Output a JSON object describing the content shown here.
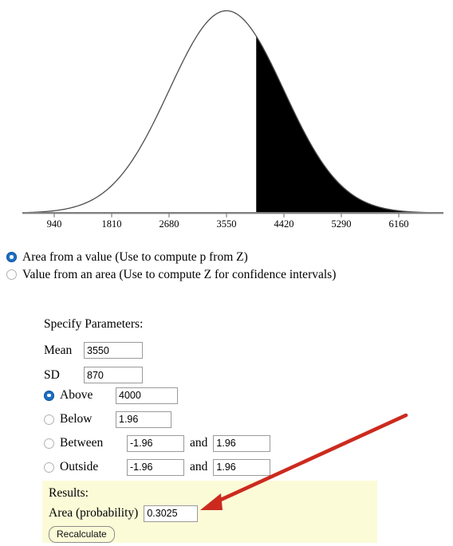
{
  "chart_data": {
    "type": "area",
    "title": "",
    "xlabel": "",
    "ylabel": "",
    "distribution": "normal",
    "mean": 3550,
    "sd": 870,
    "xlim": [
      480,
      6720
    ],
    "tick_values": [
      940,
      1810,
      2680,
      3550,
      4420,
      5290,
      6160
    ],
    "tick_labels": [
      "940",
      "1810",
      "2680",
      "3550",
      "4420",
      "5290",
      "6160"
    ],
    "shaded_region": {
      "type": "above",
      "from": 4000,
      "to": 6720,
      "area": 0.3025,
      "fill_color": "#000000"
    },
    "curve_color": "#4d4d4d",
    "axis_color": "#808080",
    "grid": false,
    "legend": false
  },
  "mode": {
    "options": [
      {
        "label": "Area from a value (Use to compute p from Z)",
        "selected": true
      },
      {
        "label": "Value from an area (Use to compute Z for confidence intervals)",
        "selected": false
      }
    ]
  },
  "parameters": {
    "title": "Specify Parameters:",
    "mean": {
      "label": "Mean",
      "value": "3550"
    },
    "sd": {
      "label": "SD",
      "value": "870"
    }
  },
  "conditions": {
    "and_label": "and",
    "rows": [
      {
        "label": "Above",
        "selected": true,
        "value1": "4000",
        "value2": null
      },
      {
        "label": "Below",
        "selected": false,
        "value1": "1.96",
        "value2": null
      },
      {
        "label": "Between",
        "selected": false,
        "value1": "-1.96",
        "value2": "1.96"
      },
      {
        "label": "Outside",
        "selected": false,
        "value1": "-1.96",
        "value2": "1.96"
      }
    ]
  },
  "results": {
    "title": "Results:",
    "area_label": "Area (probability)",
    "area_value": "0.3025",
    "recalculate_label": "Recalculate",
    "background_color": "#fbfbd8"
  },
  "annotation": {
    "arrow_color": "#cc2a1e",
    "points_to": "area-probability-field"
  }
}
